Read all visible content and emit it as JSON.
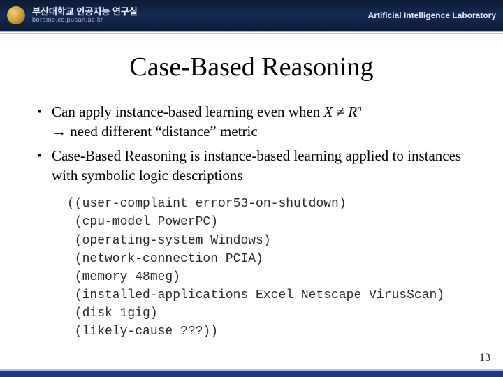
{
  "header": {
    "org_kr": "부산대학교 인공지능 연구실",
    "org_url": "borame.cs.pusan.ac.kr",
    "lab": "Artificial Intelligence Laboratory"
  },
  "title": "Case-Based Reasoning",
  "bullets": {
    "b1_pre": "Can apply instance-based learning even when ",
    "b1_X": "X",
    "b1_neq": " ≠ ",
    "b1_R": "R",
    "b1_sup": "n",
    "b1_l2": " need different “distance” metric",
    "b2": "Case-Based Reasoning is instance-based learning applied to instances with symbolic logic descriptions"
  },
  "code_lines": [
    "((user-complaint error53-on-shutdown)",
    " (cpu-model PowerPC)",
    " (operating-system Windows)",
    " (network-connection PCIA)",
    " (memory 48meg)",
    " (installed-applications Excel Netscape VirusScan)",
    " (disk 1gig)",
    " (likely-cause ???))"
  ],
  "page_number": "13",
  "bullet_marker": "▪",
  "arrow": "→"
}
